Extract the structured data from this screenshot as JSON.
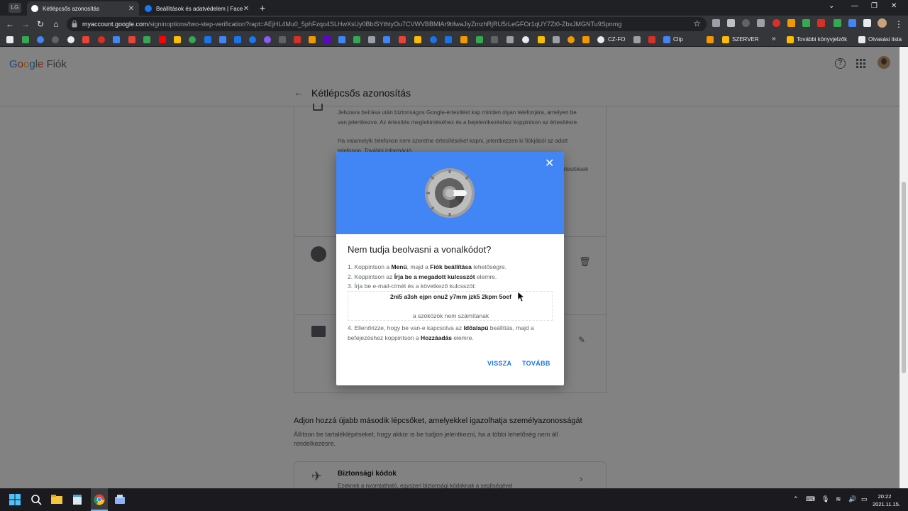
{
  "browser": {
    "window_icon_label": "LG",
    "tabs": [
      {
        "title": "Kétlépcsős azonosítás",
        "active": true
      },
      {
        "title": "Beállítások és adatvédelem | Faceb",
        "active": false
      }
    ],
    "url_host": "myaccount.google.com",
    "url_path": "/signinoptions/two-step-verification?rapt=AEjHL4Mu0_5phFzqo4SLHwXsUy0BbiSYthtyOu7CVWVBBMlAr9tifwaJiyZmzhRjRU5rLeGFOr1qUY7Zt0-ZbxJMGNTu9Spnmg",
    "bookmarks": {
      "cz_fo": "CZ-FO",
      "clip": "Clip",
      "szerver": "SZERVER",
      "more_chevron": "»",
      "other": "További könyvjelzők",
      "reading_list": "Olvasási lista"
    }
  },
  "header": {
    "logo_google": [
      "G",
      "o",
      "o",
      "g",
      "l",
      "e"
    ],
    "logo_suffix": "Fiók",
    "page_title": "Kétlépcsős azonosítás"
  },
  "background": {
    "prompt_text_1": "Jelszava beírása után biztonságos Google-értesítést kap minden olyan telefonjára, amelyen be van jelentkezve. Az értesítés megtekintéséhez és a bejelentkezéshez koppintson az értesítésre.",
    "prompt_text_2": "Ha valamelyik telefonon nem szeretne értesítéseket kapni, jelentkezzen ki fiókjából az adott telefonon. További információ",
    "prompt_text_fragment": "értesítések",
    "add_heading": "Adjon hozzá újabb második lépcsőket, amelyekkel igazolhatja személyazonosságát",
    "add_desc": "Állítson be tartaléklépéseket, hogy akkor is be tudjon jelentkezni, ha a többi lehetőség nem áll rendelkezésre.",
    "backup_title": "Biztonsági kódok",
    "backup_desc": "Ezeknek a nyomtatható, egyszeri biztonsági kódoknak a segítségével"
  },
  "dialog": {
    "title": "Nem tudja beolvasni a vonalkódot?",
    "step1_pre": "1. Koppintson a ",
    "step1_b1": "Menü",
    "step1_mid": ", majd a ",
    "step1_b2": "Fiók beállítása",
    "step1_post": " lehetőségre.",
    "step2_pre": "2. Koppintson az ",
    "step2_b": "Írja be a megadott kulcsszót",
    "step2_post": " elemre.",
    "step3": "3. Írja be e-mail-címét és a következő kulcsszót:",
    "secret_key": "2ni5 a3sh ejpn onu2 y7mm jzk5 2kpm 5oef",
    "spaces_note": "a szóközök nem számítanak",
    "step4_pre": "4. Ellenőrizze, hogy be van-e kapcsolva az ",
    "step4_b1": "Időalapú",
    "step4_mid": " beállítás, majd a befejezéshez koppintson a ",
    "step4_b2": "Hozzáadás",
    "step4_post": " elemre.",
    "back_button": "VISSZA",
    "next_button": "TOVÁBB"
  },
  "taskbar": {
    "time": "20:22",
    "date": "2021.11.15."
  },
  "colors": {
    "dialog_banner": "#4285f4",
    "link_blue": "#1a73e8"
  }
}
